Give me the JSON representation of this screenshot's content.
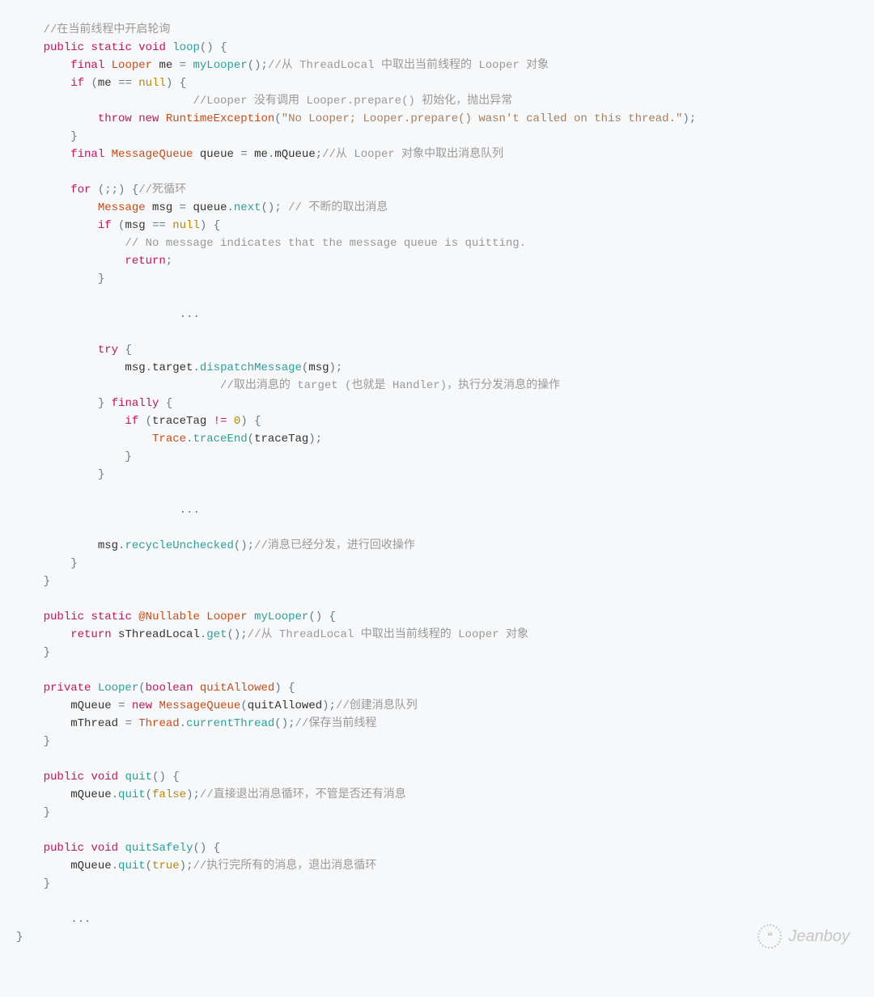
{
  "code": {
    "c_open_polling": "//在当前线程中开启轮询",
    "kw_public": "public",
    "kw_static": "static",
    "kw_void": "void",
    "fn_loop": "loop",
    "kw_final": "final",
    "ty_Looper": "Looper",
    "id_me": "me",
    "fn_myLooper": "myLooper",
    "c_from_threadlocal": "//从 ThreadLocal 中取出当前线程的 Looper 对象",
    "kw_if": "if",
    "lit_null": "null",
    "c_no_prepare": "//Looper 没有调用 Looper.prepare() 初始化，抛出异常",
    "kw_throw": "throw",
    "kw_new": "new",
    "ty_RuntimeException": "RuntimeException",
    "str_nolooper": "\"No Looper; Looper.prepare() wasn't called on this thread.\"",
    "ty_MessageQueue": "MessageQueue",
    "id_queue": "queue",
    "id_mQueue": "mQueue",
    "c_take_queue": "//从 Looper 对象中取出消息队列",
    "kw_for": "for",
    "c_deadloop": "//死循环",
    "ty_Message": "Message",
    "id_msg": "msg",
    "fn_next": "next",
    "c_keep_taking": "// 不断的取出消息",
    "c_no_message": "// No message indicates that the message queue is quitting.",
    "kw_return": "return",
    "ellipsis": "...",
    "kw_try": "try",
    "id_target": "target",
    "fn_dispatchMessage": "dispatchMessage",
    "c_dispatch": "//取出消息的 target (也就是 Handler)，执行分发消息的操作",
    "kw_finally": "finally",
    "id_traceTag": "traceTag",
    "lit_zero": "0",
    "ty_Trace": "Trace",
    "fn_traceEnd": "traceEnd",
    "fn_recycleUnchecked": "recycleUnchecked",
    "c_recycle": "//消息已经分发，进行回收操作",
    "ann_Nullable": "@Nullable",
    "id_sThreadLocal": "sThreadLocal",
    "fn_get": "get",
    "kw_private": "private",
    "kw_boolean": "boolean",
    "param_quitAllowed": "quitAllowed",
    "c_create_queue": "//创建消息队列",
    "id_mThread": "mThread",
    "ty_Thread": "Thread",
    "fn_currentThread": "currentThread",
    "c_save_thread": "//保存当前线程",
    "fn_quit": "quit",
    "lit_false": "false",
    "c_direct_quit": "//直接退出消息循环，不管是否还有消息",
    "fn_quitSafely": "quitSafely",
    "lit_true": "true",
    "c_safe_quit": "//执行完所有的消息，退出消息循环"
  },
  "watermark": {
    "text": "Jeanboy"
  }
}
